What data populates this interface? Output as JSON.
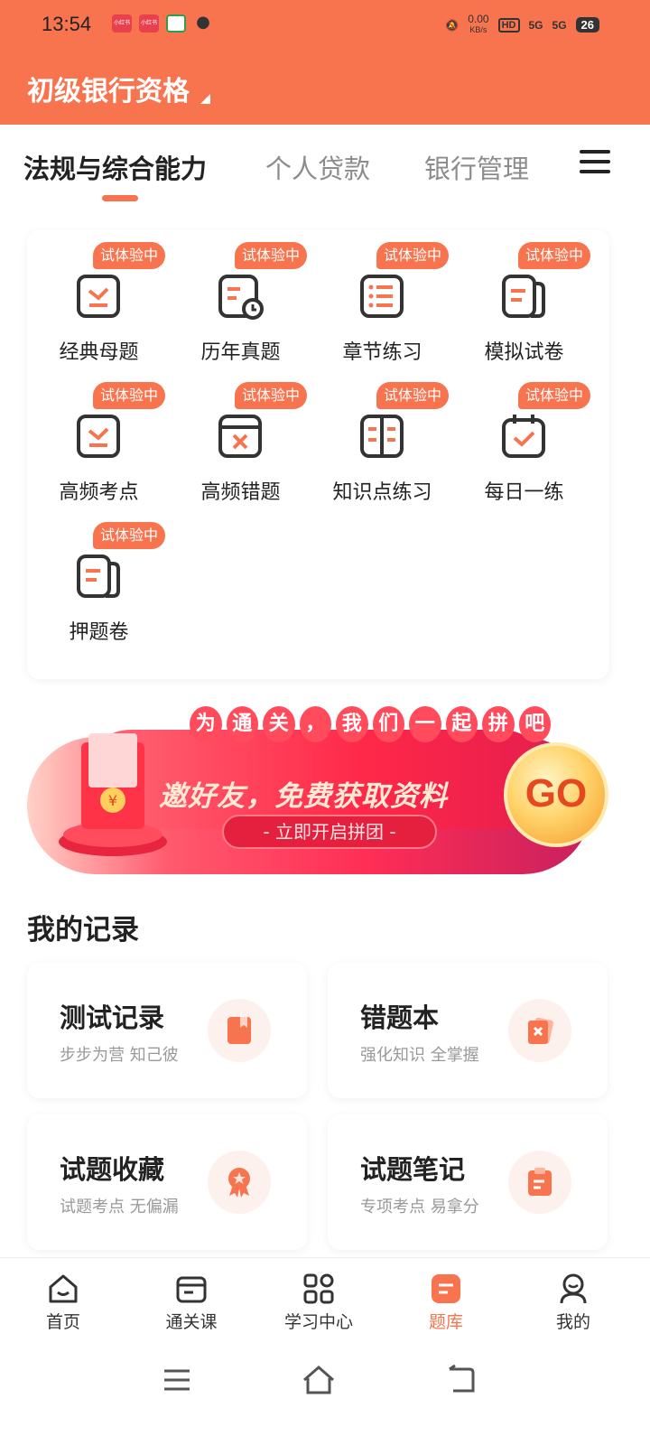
{
  "status_bar": {
    "time": "13:54",
    "app_notifications": [
      "小红书",
      "小红书",
      "",
      ""
    ],
    "net_speed": "0.00",
    "net_unit": "KB/s",
    "hd": "HD",
    "signal_1": "5G",
    "signal_2": "5G",
    "battery": "26"
  },
  "header": {
    "title": "初级银行资格"
  },
  "tabs": [
    {
      "label": "法规与综合能力",
      "active": true
    },
    {
      "label": "个人贷款",
      "active": false
    },
    {
      "label": "银行管理",
      "active": false
    }
  ],
  "grid": {
    "badge_text": "试体验中",
    "items": [
      {
        "label": "经典母题",
        "icon": "checkmark-doc-icon"
      },
      {
        "label": "历年真题",
        "icon": "history-exam-icon"
      },
      {
        "label": "章节练习",
        "icon": "list-doc-icon"
      },
      {
        "label": "模拟试卷",
        "icon": "paper-stack-icon"
      },
      {
        "label": "高频考点",
        "icon": "checkmark-doc-icon"
      },
      {
        "label": "高频错题",
        "icon": "wrong-question-icon"
      },
      {
        "label": "知识点练习",
        "icon": "open-book-icon"
      },
      {
        "label": "每日一练",
        "icon": "calendar-check-icon"
      },
      {
        "label": "押题卷",
        "icon": "paper-stack-icon"
      }
    ]
  },
  "banner": {
    "top_chars": [
      "为",
      "通",
      "关",
      "，",
      "我",
      "们",
      "一",
      "起",
      "拼",
      "吧"
    ],
    "main_text": "邀好友，免费获取资料",
    "sub_text": "- 立即开启拼团 -",
    "go_text": "GO"
  },
  "records": {
    "section_title": "我的记录",
    "items": [
      {
        "title": "测试记录",
        "subtitle": "步步为营 知己彼",
        "icon": "bookmark-icon"
      },
      {
        "title": "错题本",
        "subtitle": "强化知识 全掌握",
        "icon": "wrong-card-icon"
      },
      {
        "title": "试题收藏",
        "subtitle": "试题考点 无偏漏",
        "icon": "star-medal-icon"
      },
      {
        "title": "试题笔记",
        "subtitle": "专项考点 易拿分",
        "icon": "clipboard-icon"
      }
    ]
  },
  "bottom_nav": [
    {
      "label": "首页",
      "icon": "home-icon",
      "active": false
    },
    {
      "label": "通关课",
      "icon": "card-icon",
      "active": false
    },
    {
      "label": "学习中心",
      "icon": "grid-icon",
      "active": false
    },
    {
      "label": "题库",
      "icon": "question-bank-icon",
      "active": true
    },
    {
      "label": "我的",
      "icon": "profile-icon",
      "active": false
    }
  ],
  "colors": {
    "accent": "#f7744f",
    "banner_red": "#ff2e55",
    "text_dark": "#222222",
    "text_muted": "#8c8c8c"
  }
}
